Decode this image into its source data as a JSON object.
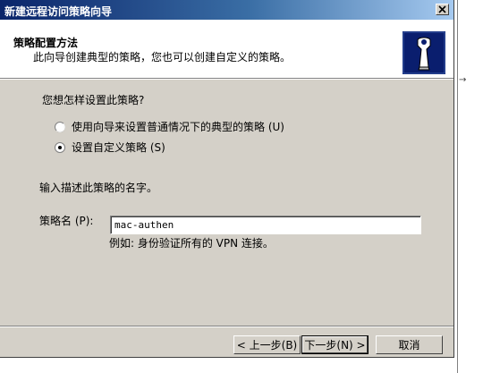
{
  "window": {
    "title": "新建远程访问策略向导"
  },
  "header": {
    "title": "策略配置方法",
    "subtitle": "此向导创建典型的策略，您也可以创建自定义的策略。"
  },
  "main": {
    "question": "您想怎样设置此策略?",
    "options": [
      {
        "label": "使用向导来设置普通情况下的典型的策略 (U)",
        "selected": false
      },
      {
        "label": "设置自定义策略 (S)",
        "selected": true
      }
    ],
    "name_prompt": "输入描述此策略的名字。",
    "policy_name_label": "策略名 (P):",
    "policy_name_value": "mac-authen",
    "example": "例如: 身份验证所有的 VPN 连接。"
  },
  "footer": {
    "back_label": "< 上一步(B)",
    "next_label": "下一步(N) >",
    "cancel_label": "取消"
  },
  "side": {
    "mark": "→"
  }
}
